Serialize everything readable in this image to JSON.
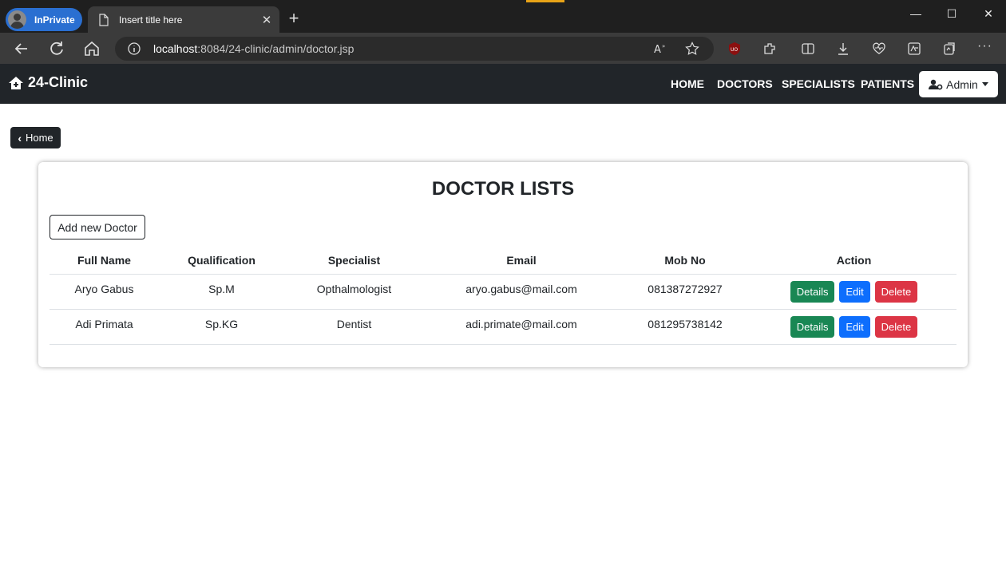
{
  "browser": {
    "inprivate_label": "InPrivate",
    "tab_title": "Insert title here",
    "url_host": "localhost",
    "url_path": ":8084/24-clinic/admin/doctor.jsp"
  },
  "site": {
    "brand": "24-Clinic",
    "nav": [
      "HOME",
      "DOCTORS",
      "SPECIALISTS",
      "PATIENTS"
    ],
    "admin_label": "Admin"
  },
  "page": {
    "home_button": "Home",
    "title": "DOCTOR LISTS",
    "add_button": "Add new Doctor"
  },
  "table": {
    "headers": [
      "Full Name",
      "Qualification",
      "Specialist",
      "Email",
      "Mob No",
      "Action"
    ],
    "rows": [
      {
        "full_name": "Aryo Gabus",
        "qualification": "Sp.M",
        "specialist": "Opthalmologist",
        "email": "aryo.gabus@mail.com",
        "mob_no": "081387272927"
      },
      {
        "full_name": "Adi Primata",
        "qualification": "Sp.KG",
        "specialist": "Dentist",
        "email": "adi.primate@mail.com",
        "mob_no": "081295738142"
      }
    ],
    "actions": {
      "details": "Details",
      "edit": "Edit",
      "delete": "Delete"
    }
  },
  "colors": {
    "navbar": "#212529",
    "details": "#198754",
    "edit": "#0d6efd",
    "delete": "#dc3545"
  }
}
